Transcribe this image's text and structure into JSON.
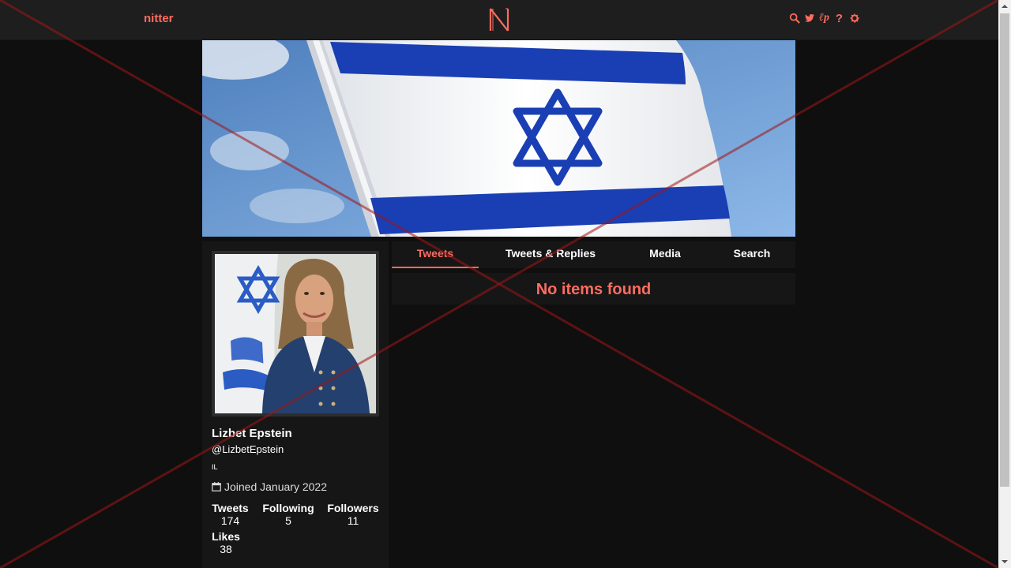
{
  "nav": {
    "brand": "nitter",
    "icons": [
      "search-icon",
      "twitter-bird-icon",
      "rss-icon",
      "help-icon",
      "gear-icon"
    ],
    "help_label": "?",
    "rss_label": "ℓp"
  },
  "banner": {
    "image": "israel-flag-banner"
  },
  "profile": {
    "fullname": "Lizbet Epstein",
    "username": "@LizbetEpstein",
    "bio": "IL",
    "joined": "Joined January 2022",
    "stats": {
      "tweets_label": "Tweets",
      "tweets": "174",
      "following_label": "Following",
      "following": "5",
      "followers_label": "Followers",
      "followers": "11",
      "likes_label": "Likes",
      "likes": "38"
    }
  },
  "tabs": [
    {
      "label": "Tweets",
      "active": true
    },
    {
      "label": "Tweets & Replies",
      "active": false
    },
    {
      "label": "Media",
      "active": false
    },
    {
      "label": "Search",
      "active": false
    }
  ],
  "timeline": {
    "empty_message": "No items found"
  },
  "colors": {
    "accent": "#ff6c60",
    "background": "#0f0f0f",
    "panel": "#161616",
    "nav": "#1e1e1e",
    "flag_blue": "#1a3fb4"
  }
}
